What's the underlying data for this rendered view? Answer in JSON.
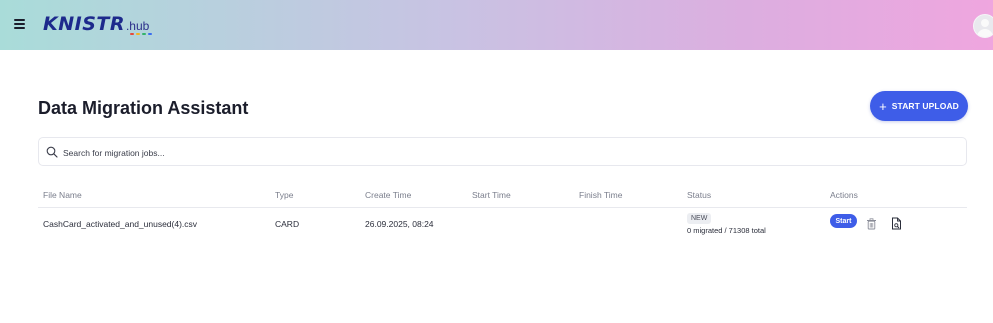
{
  "header": {
    "logo_main": "knistr",
    "logo_suffix": ".hub",
    "logo_dot_colors": [
      "#e64a3c",
      "#f2b321",
      "#34b36a",
      "#3a6df0"
    ],
    "gradient_colors": [
      "#a9dcd9",
      "#c8c3e3",
      "#dcaee0",
      "#efa6df"
    ],
    "icons": {
      "menu": "hamburger-menu-icon",
      "avatar": "user-avatar-icon"
    }
  },
  "page": {
    "title": "Data Migration Assistant",
    "upload_button": {
      "icon": "plus-icon",
      "label": "START UPLOAD",
      "color": "#3e5de8"
    }
  },
  "search": {
    "placeholder": "Search for migration jobs...",
    "value": "",
    "icon": "search-icon"
  },
  "table": {
    "columns": [
      "File Name",
      "Type",
      "Create Time",
      "Start Time",
      "Finish Time",
      "Status",
      "Actions"
    ],
    "rows": [
      {
        "file_name": "CashCard_activated_and_unused(4).csv",
        "type": "CARD",
        "create_time": "26.09.2025, 08:24",
        "start_time": "",
        "finish_time": "",
        "status_badge": "NEW",
        "status_detail": "0 migrated / 71308 total",
        "actions": {
          "start_label": "Start",
          "delete_icon": "trash-icon",
          "report_icon": "document-icon"
        }
      }
    ]
  }
}
